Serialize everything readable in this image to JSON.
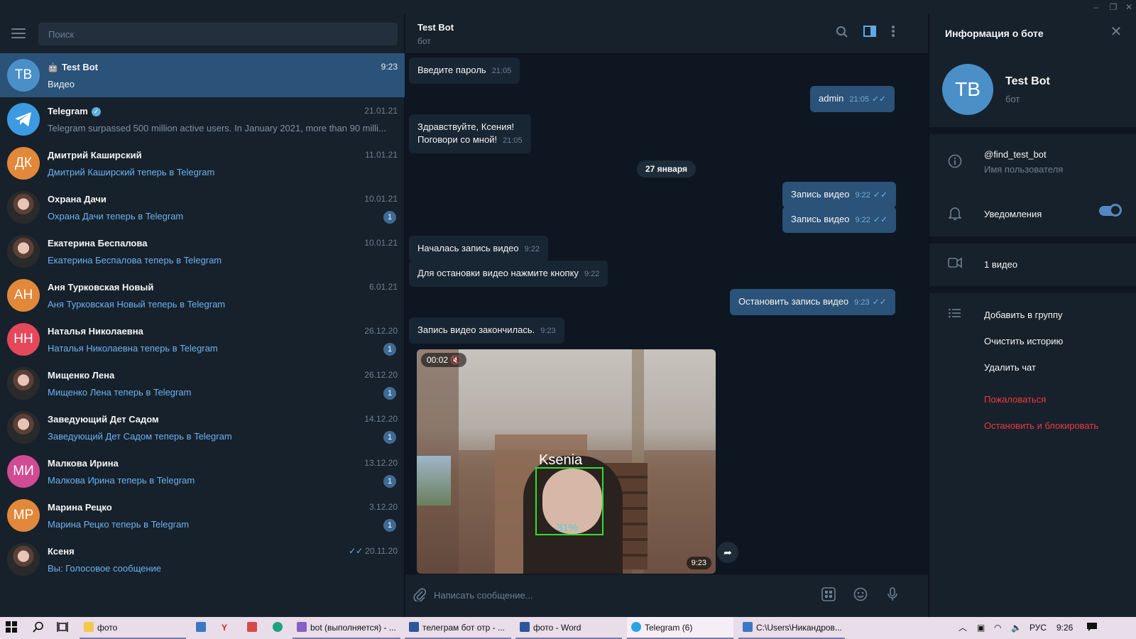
{
  "window": {
    "minimize": "–",
    "restore": "❐",
    "close": "✕"
  },
  "search": {
    "placeholder": "Поиск"
  },
  "chats": [
    {
      "initials": "TB",
      "avatar_color": "#4b8fc9",
      "name": "Test Bot",
      "preview": "Видео",
      "time": "9:23",
      "badge": "",
      "bot": true,
      "active": true
    },
    {
      "initials": "",
      "avatar_color": "#3d9ae0",
      "name": "Telegram",
      "preview": "Telegram surpassed 500 million active users.    In January 2021, more than 90 milli...",
      "time": "21.01.21",
      "badge": "",
      "verified": true,
      "grey": true
    },
    {
      "initials": "ДК",
      "avatar_color": "#e2883a",
      "name": "Дмитрий Каширский",
      "preview": "Дмитрий Каширский теперь в Telegram",
      "time": "11.01.21",
      "badge": ""
    },
    {
      "initials": "",
      "avatar_color": "photo",
      "name": "Охрана Дачи",
      "preview": "Охрана Дачи теперь в Telegram",
      "time": "10.01.21",
      "badge": "1"
    },
    {
      "initials": "",
      "avatar_color": "photo",
      "name": "Екатерина Беспалова",
      "preview": "Екатерина Беспалова теперь в Telegram",
      "time": "10.01.21",
      "badge": ""
    },
    {
      "initials": "АН",
      "avatar_color": "#e2883a",
      "name": "Аня Турковская Новый",
      "preview": "Аня Турковская Новый теперь в Telegram",
      "time": "6.01.21",
      "badge": ""
    },
    {
      "initials": "НН",
      "avatar_color": "#e5485a",
      "name": "Наталья Николаевна",
      "preview": "Наталья Николаевна теперь в Telegram",
      "time": "26.12.20",
      "badge": "1"
    },
    {
      "initials": "",
      "avatar_color": "photo",
      "name": "Мищенко Лена",
      "preview": "Мищенко Лена теперь в Telegram",
      "time": "26.12.20",
      "badge": "1"
    },
    {
      "initials": "",
      "avatar_color": "photo",
      "name": "Заведующий Дет Садом",
      "preview": "Заведующий Дет Садом теперь в Telegram",
      "time": "14.12.20",
      "badge": "1"
    },
    {
      "initials": "МИ",
      "avatar_color": "#d14a94",
      "name": "Малкова Ирина",
      "preview": "Малкова Ирина теперь в Telegram",
      "time": "13.12.20",
      "badge": "1"
    },
    {
      "initials": "МР",
      "avatar_color": "#e2883a",
      "name": "Марина Рецко",
      "preview": "Марина Рецко теперь в Telegram",
      "time": "3.12.20",
      "badge": "1"
    },
    {
      "initials": "",
      "avatar_color": "photo",
      "name": "Ксеня",
      "preview": "Вы: Голосовое сообщение",
      "time": "20.11.20",
      "badge": "",
      "read": true
    }
  ],
  "chat": {
    "title": "Test Bot",
    "subtitle": "бот",
    "date_separator": "27 января",
    "messages": [
      {
        "dir": "in",
        "text": "Введите пароль",
        "time": "21:05"
      },
      {
        "dir": "out",
        "text": "admin",
        "time": "21:05"
      },
      {
        "dir": "in",
        "text": "Здравствуйте, Ксения!",
        "text2": "Поговори со мной!",
        "time": "21:05"
      },
      {
        "dir": "out",
        "text": "Запись видео",
        "time": "9:22"
      },
      {
        "dir": "out",
        "text": "Запись видео",
        "time": "9:22"
      },
      {
        "dir": "in",
        "text": "Началась запись видео",
        "time": "9:22"
      },
      {
        "dir": "in",
        "text": "Для остановки видео нажмите кнопку",
        "time": "9:22"
      },
      {
        "dir": "out",
        "text": "Остановить запись видео",
        "time": "9:23"
      },
      {
        "dir": "in",
        "text": "Запись видео закончилась.",
        "time": "9:23"
      }
    ],
    "video": {
      "duration": "00:02",
      "time": "9:23",
      "face_label": "Ksenia",
      "face_confidence": "31%"
    },
    "composer_placeholder": "Написать сообщение..."
  },
  "info": {
    "title": "Информация о боте",
    "initials": "TB",
    "name": "Test Bot",
    "subtitle": "бот",
    "username": "@find_test_bot",
    "username_label": "Имя пользователя",
    "notifications": "Уведомления",
    "notifications_on": true,
    "media": "1 видео",
    "add_to_group": "Добавить в группу",
    "clear_history": "Очистить историю",
    "delete_chat": "Удалить чат",
    "report": "Пожаловаться",
    "stop_block": "Остановить и блокировать"
  },
  "taskbar": {
    "items": [
      {
        "label": "фото",
        "icon_color": "#f3c84b"
      },
      {
        "label": "bot (выполняется) - ...",
        "icon_color": "#8661c5"
      },
      {
        "label": "телеграм бот отр - ...",
        "icon_color": "#2b579a"
      },
      {
        "label": "фото - Word",
        "icon_color": "#2b579a"
      },
      {
        "label": "Telegram (6)",
        "icon_color": "#2aa3e0"
      },
      {
        "label": "C:\\Users\\Никандров...",
        "icon_color": "#3b78c4"
      }
    ],
    "lang": "РУС",
    "clock": "9:26"
  }
}
